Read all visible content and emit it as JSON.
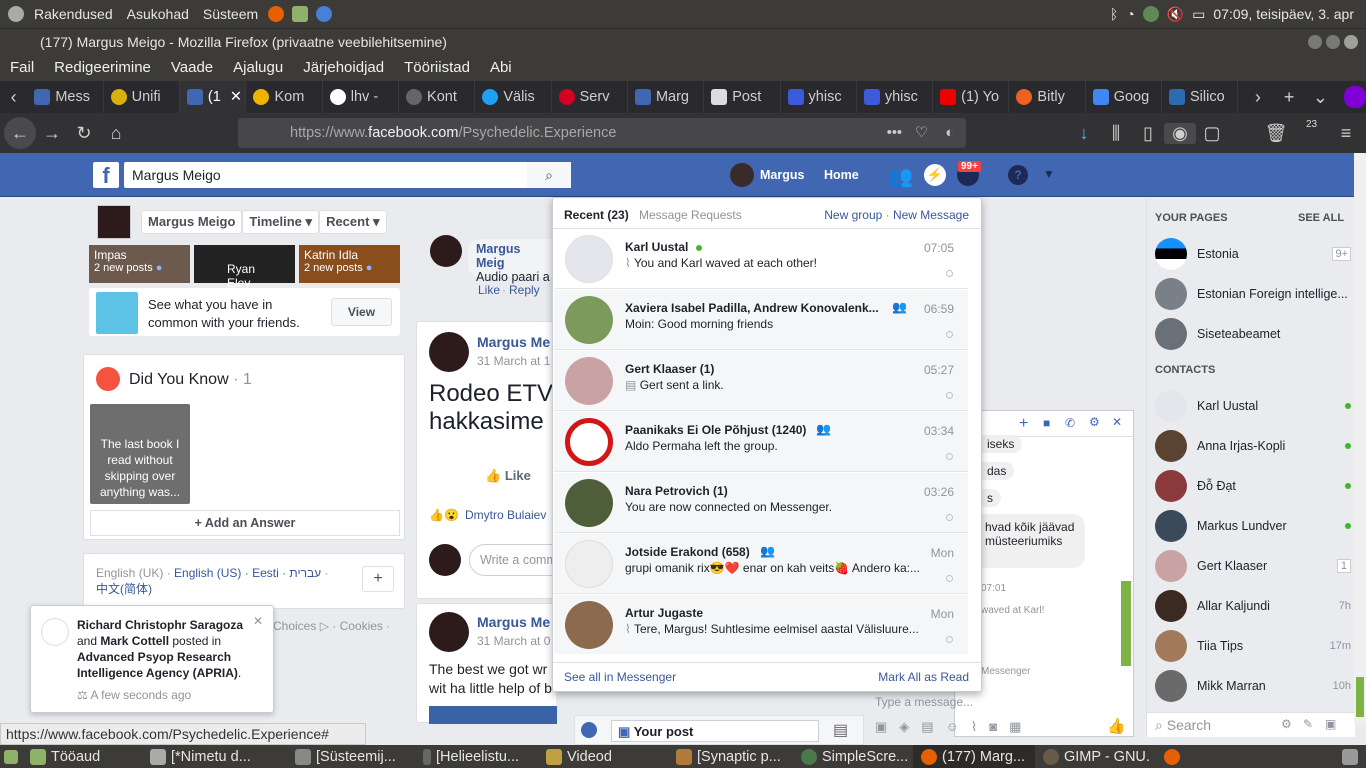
{
  "os": {
    "menus": [
      "Rakendused",
      "Asukohad",
      "Süsteem"
    ],
    "clock": "07:09, teisipäev, 3. apr"
  },
  "window": {
    "title": "(177) Margus Meigo - Mozilla Firefox (privaatne veebilehitsemine)"
  },
  "menubar": [
    "Fail",
    "Redigeerimine",
    "Vaade",
    "Ajalugu",
    "Järjehoidjad",
    "Tööriistad",
    "Abi"
  ],
  "tabs": [
    "Mess",
    "Unifi",
    "(1",
    "Kom",
    "lhv -",
    "Kont",
    "Välis",
    "Serv",
    "Marg",
    "Post",
    "yhisc",
    "yhisc",
    "(1) Yo",
    "Bitly",
    "Goog",
    "Silico"
  ],
  "url": {
    "prefix": "https://www.",
    "domain": "facebook.com",
    "path": "/Psychedelic.Experience"
  },
  "badges": {
    "downloads": "23",
    "notifications": "99+"
  },
  "fb": {
    "search": "Margus Meigo",
    "user": "Margus",
    "home": "Home",
    "profile_nav": {
      "name": "Margus Meigo",
      "timeline": "Timeline",
      "recent": "Recent"
    },
    "thumbs": [
      {
        "name": "Impas",
        "sub": "2 new posts"
      },
      {
        "name": "Ryan Eley",
        "sub": ""
      },
      {
        "name": "Katrin Idla",
        "sub": "2 new posts"
      }
    ],
    "common": {
      "text": "See what you have in common with your friends.",
      "button": "View"
    },
    "dyk": {
      "title": "Did You Know",
      "count": " · 1",
      "card": "The last book I read without skipping over anything was...",
      "answer": "+ Add an Answer"
    },
    "langs": {
      "l1": "English (UK) ·",
      "l2": "English (US)",
      "l3": "· Eesti ·",
      "l4": "עברית",
      "l5": "·",
      "l6": "中文(简体)"
    },
    "footer": "Choices ▷ · Cookies ·",
    "toast": {
      "who1": "Richard Christophr Saragoza",
      "mid": " and ",
      "who2": "Mark Cottell",
      "posted": " posted in ",
      "group": "Advanced Psyop Research Intelligence Agency (APRIA)",
      "time": "A few seconds ago"
    },
    "feed": {
      "post1_name": "Margus Meig",
      "post1_text": "Audio paari a",
      "like": "Like",
      "reply": "Reply",
      "post2_name": "Margus Me",
      "post2_date": "31 March at 1",
      "post2_big1": "Rodeo ETV",
      "post2_big2": "hakkasime",
      "like_btn": "Like",
      "reactors": "Dmytro Bulaiev",
      "comment_ph": "Write a comm",
      "post3_name": "Margus Me",
      "post3_date": "31 March at 0",
      "post3_text1": "The best we got wr",
      "post3_text2": "wit ha little help of b"
    },
    "yourpost": "Your post"
  },
  "messenger": {
    "recent": "Recent",
    "recent_count": "(23)",
    "requests": "Message Requests",
    "new_group": "New group",
    "sep": " · ",
    "new_message": "New Message",
    "threads": [
      {
        "name": "Karl Uustal",
        "text": "You and Karl waved at each other!",
        "time": "07:05"
      },
      {
        "name": "Xaviera Isabel Padilla, Andrew Konovalenk...",
        "text": "Moin: Good morning friends",
        "time": "06:59"
      },
      {
        "name": "Gert Klaaser (1)",
        "text": "Gert sent a link.",
        "time": "05:27"
      },
      {
        "name": "Paanikaks Ei Ole Põhjust (1240)",
        "text": "Aldo Permaha left the group.",
        "time": "03:34"
      },
      {
        "name": "Nara Petrovich (1)",
        "text": "You are now connected on Messenger.",
        "time": "03:26"
      },
      {
        "name": "Jotside Erakond (658)",
        "text": "grupi omanik rix😎❤️ enar on kah veits🍓 Andero ka:...",
        "time": "Mon"
      },
      {
        "name": "Artur Jugaste",
        "text": "Tere, Margus! Suhtlesime eelmisel aastal Välisluure...",
        "time": "Mon"
      }
    ],
    "see_all": "See all in Messenger",
    "mark_read": "Mark All as Read"
  },
  "chat": {
    "frag": [
      "iseks",
      "das",
      "s",
      "hvad kõik jäävad",
      "müsteeriumiks",
      "07:01",
      "waved at Karl!",
      "Messenger"
    ],
    "input_ph": "Type a message..."
  },
  "sidebar": {
    "your_pages": "YOUR PAGES",
    "see_all": "SEE ALL",
    "pages": [
      {
        "name": "Estonia",
        "badge": "9+"
      },
      {
        "name": "Estonian Foreign intellige...",
        "badge": ""
      },
      {
        "name": "Siseteabeamet",
        "badge": ""
      }
    ],
    "contacts_title": "CONTACTS",
    "contacts": [
      {
        "name": "Karl Uustal",
        "status": "online"
      },
      {
        "name": "Anna Irjas-Kopli",
        "status": "online"
      },
      {
        "name": "Đỗ Đạt",
        "status": "online"
      },
      {
        "name": "Markus Lundver",
        "status": "online"
      },
      {
        "name": "Gert Klaaser",
        "status": "1"
      },
      {
        "name": "Allar Kaljundi",
        "status": "7h"
      },
      {
        "name": "Tiia Tips",
        "status": "17m"
      },
      {
        "name": "Mikk Marran",
        "status": "10h"
      }
    ],
    "search": "Search"
  },
  "statusbar": "https://www.facebook.com/Psychedelic.Experience#",
  "taskbar": [
    "Tööaud",
    "[*Nimetu d...",
    "[Süsteemij...",
    "[Helieelistu...",
    "Videod",
    "[Synaptic p...",
    "SimpleScre...",
    "(177) Marg...",
    "GIMP - GNU..."
  ],
  "colors": {
    "fb_blue": "#4267b2",
    "link": "#385898",
    "online": "#42b72a",
    "badge_red": "#fa3e3e"
  }
}
